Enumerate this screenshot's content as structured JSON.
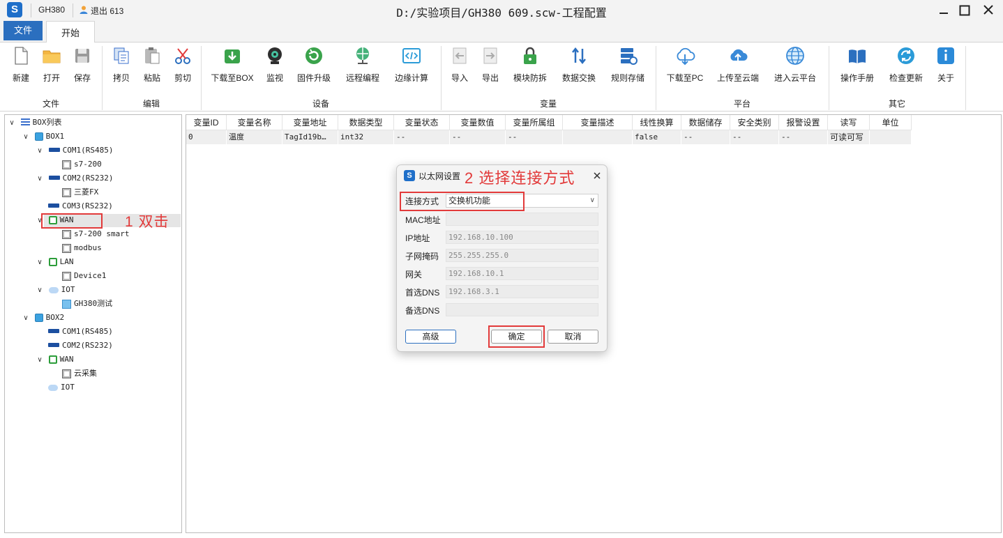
{
  "titlebar": {
    "logo": "S",
    "project": "GH380",
    "user": "退出 613",
    "title": "D:/实验项目/GH380 609.scw-工程配置"
  },
  "tabs": {
    "file": "文件",
    "home": "开始"
  },
  "ribbon": {
    "groups": [
      {
        "label": "文件",
        "buttons": [
          "新建",
          "打开",
          "保存"
        ]
      },
      {
        "label": "编辑",
        "buttons": [
          "拷贝",
          "粘贴",
          "剪切"
        ]
      },
      {
        "label": "设备",
        "buttons": [
          "下载至BOX",
          "监视",
          "固件升级",
          "远程编程",
          "边缘计算"
        ]
      },
      {
        "label": "变量",
        "buttons": [
          "导入",
          "导出",
          "模块防拆",
          "数据交换",
          "规则存储"
        ]
      },
      {
        "label": "平台",
        "buttons": [
          "下载至PC",
          "上传至云端",
          "进入云平台"
        ]
      },
      {
        "label": "其它",
        "buttons": [
          "操作手册",
          "检查更新",
          "关于"
        ]
      }
    ]
  },
  "tree": {
    "items": [
      "BOX列表",
      "BOX1",
      "COM1(RS485)",
      "s7-200",
      "COM2(RS232)",
      "三菱FX",
      "COM3(RS232)",
      "WAN",
      "s7-200 smart",
      "modbus",
      "LAN",
      "Device1",
      "IOT",
      "GH380测试",
      "BOX2",
      "COM1(RS485)",
      "COM2(RS232)",
      "WAN",
      "云采集",
      "IOT"
    ]
  },
  "annotations": {
    "step1": "1 双击",
    "step2": "2 选择连接方式"
  },
  "table": {
    "headers": [
      "变量ID",
      "变量名称",
      "变量地址",
      "数据类型",
      "变量状态",
      "变量数值",
      "变量所属组",
      "变量描述",
      "线性换算",
      "数据储存",
      "安全类别",
      "报警设置",
      "读写",
      "单位"
    ],
    "rows": [
      [
        "0",
        "温度",
        "TagId19b…",
        "int32",
        "--",
        "--",
        "--",
        "",
        "false",
        "--",
        "--",
        "--",
        "可读可写",
        ""
      ]
    ]
  },
  "dialog": {
    "title": "以太网设置",
    "fields": {
      "conn_label": "连接方式",
      "conn_value": "交换机功能",
      "mac_label": "MAC地址",
      "mac_value": "",
      "ip_label": "IP地址",
      "ip_value": "192.168.10.100",
      "mask_label": "子网掩码",
      "mask_value": "255.255.255.0",
      "gw_label": "网关",
      "gw_value": "192.168.10.1",
      "dns1_label": "首选DNS",
      "dns1_value": "192.168.3.1",
      "dns2_label": "备选DNS",
      "dns2_value": ""
    },
    "buttons": {
      "advanced": "高级",
      "ok": "确定",
      "cancel": "取消"
    }
  },
  "colors": {
    "accent": "#2b6fbf",
    "annotation": "#e23a3a",
    "green_icon": "#3aa34b"
  }
}
